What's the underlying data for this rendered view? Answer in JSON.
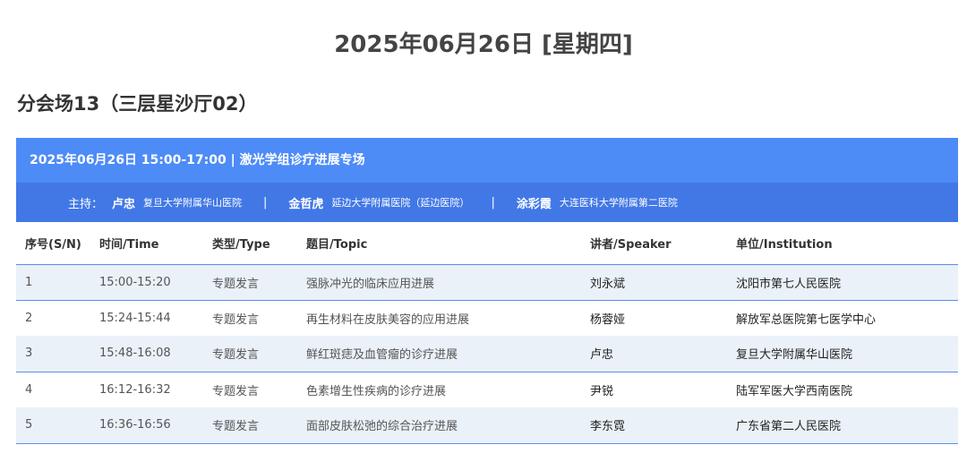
{
  "page": {
    "date_title": "2025年06月26日 [星期四]",
    "venue_title": "分会场13（三层星沙厅02）"
  },
  "session": {
    "header": "2025年06月26日 15:00-17:00 | 激光学组诊疗进展专场",
    "hosts_label": "主持：",
    "hosts": [
      {
        "name": "卢忠",
        "institution": "复旦大学附属华山医院"
      },
      {
        "name": "金哲虎",
        "institution": "延边大学附属医院（延边医院）"
      },
      {
        "name": "涂彩霞",
        "institution": "大连医科大学附属第二医院"
      }
    ],
    "separator": "|"
  },
  "table": {
    "columns": [
      "序号(S/N)",
      "时间/Time",
      "类型/Type",
      "题目/Topic",
      "讲者/Speaker",
      "单位/Institution"
    ],
    "rows": [
      {
        "sn": "1",
        "time": "15:00-15:20",
        "type": "专题发言",
        "topic": "强脉冲光的临床应用进展",
        "speaker": "刘永斌",
        "institution": "沈阳市第七人民医院"
      },
      {
        "sn": "2",
        "time": "15:24-15:44",
        "type": "专题发言",
        "topic": "再生材料在皮肤美容的应用进展",
        "speaker": "杨蓉娅",
        "institution": "解放军总医院第七医学中心"
      },
      {
        "sn": "3",
        "time": "15:48-16:08",
        "type": "专题发言",
        "topic": "鲜红斑痣及血管瘤的诊疗进展",
        "speaker": "卢忠",
        "institution": "复旦大学附属华山医院"
      },
      {
        "sn": "4",
        "time": "16:12-16:32",
        "type": "专题发言",
        "topic": "色素增生性疾病的诊疗进展",
        "speaker": "尹锐",
        "institution": "陆军军医大学西南医院"
      },
      {
        "sn": "5",
        "time": "16:36-16:56",
        "type": "专题发言",
        "topic": "面部皮肤松弛的综合治疗进展",
        "speaker": "李东霓",
        "institution": "广东省第二人民医院"
      }
    ]
  },
  "colors": {
    "header_blue": "#4d8bf7",
    "hosts_blue": "#4278e6",
    "row_shade": "#eaf1f8",
    "row_border": "#5a8ef0"
  }
}
